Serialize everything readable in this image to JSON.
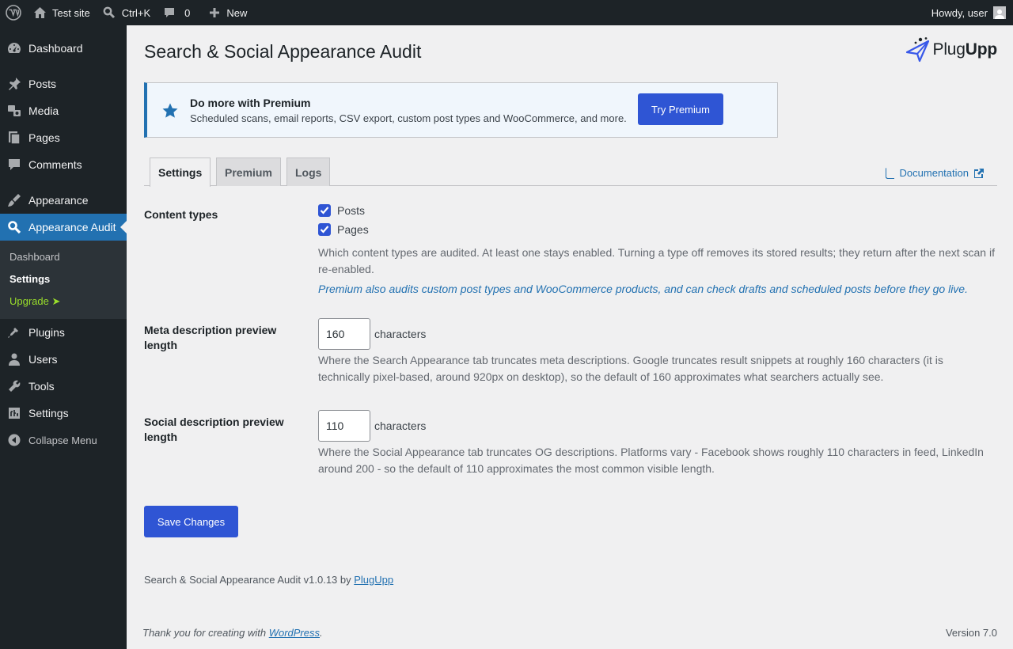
{
  "adminbar": {
    "site_name": "Test site",
    "search_shortcut": "Ctrl+K",
    "comments_count": "0",
    "new_label": "New",
    "greeting": "Howdy, user"
  },
  "sidebar": {
    "items": [
      {
        "label": "Dashboard",
        "icon": "dashboard-icon"
      },
      {
        "label": "Posts",
        "icon": "pin-icon"
      },
      {
        "label": "Media",
        "icon": "media-icon"
      },
      {
        "label": "Pages",
        "icon": "pages-icon"
      },
      {
        "label": "Comments",
        "icon": "comment-icon"
      },
      {
        "label": "Appearance",
        "icon": "brush-icon"
      },
      {
        "label": "Appearance Audit",
        "icon": "search-icon"
      },
      {
        "label": "Plugins",
        "icon": "plugin-icon"
      },
      {
        "label": "Users",
        "icon": "user-icon"
      },
      {
        "label": "Tools",
        "icon": "wrench-icon"
      },
      {
        "label": "Settings",
        "icon": "settings-icon"
      }
    ],
    "submenu": [
      "Dashboard",
      "Settings",
      "Upgrade ➤"
    ],
    "collapse_label": "Collapse Menu"
  },
  "page": {
    "title": "Search & Social Appearance Audit",
    "logo_text_light": "Plug",
    "logo_text_bold": "Upp"
  },
  "notice": {
    "title": "Do more with Premium",
    "text": "Scheduled scans, email reports, CSV export, custom post types and WooCommerce, and more.",
    "button": "Try Premium"
  },
  "tabs": [
    "Settings",
    "Premium",
    "Logs"
  ],
  "documentation_link": "Documentation",
  "content_types": {
    "label": "Content types",
    "options": [
      {
        "label": "Posts",
        "checked": true
      },
      {
        "label": "Pages",
        "checked": true
      }
    ],
    "description": "Which content types are audited. At least one stays enabled. Turning a type off removes its stored results; they return after the next scan if re-enabled.",
    "premium_note": "Premium also audits custom post types and WooCommerce products, and can check drafts and scheduled posts before they go live."
  },
  "meta_length": {
    "label": "Meta description preview length",
    "value": "160",
    "unit": "characters",
    "description": "Where the Search Appearance tab truncates meta descriptions. Google truncates result snippets at roughly 160 characters (it is technically pixel-based, around 920px on desktop), so the default of 160 approximates what searchers actually see."
  },
  "social_length": {
    "label": "Social description preview length",
    "value": "110",
    "unit": "characters",
    "description": "Where the Social Appearance tab truncates OG descriptions. Platforms vary - Facebook shows roughly 110 characters in feed, LinkedIn around 200 - so the default of 110 approximates the most common visible length."
  },
  "save_button": "Save Changes",
  "plugin_footer": {
    "text": "Search & Social Appearance Audit v1.0.13 by",
    "link": "PlugUpp"
  },
  "wp_footer": {
    "text": "Thank you for creating with",
    "link": "WordPress",
    "suffix": ".",
    "version": "Version 7.0"
  },
  "colors": {
    "adminbar": "#1d2327",
    "accent": "#2271b1",
    "button": "#2f55d4",
    "upgrade": "#9ade2b"
  }
}
